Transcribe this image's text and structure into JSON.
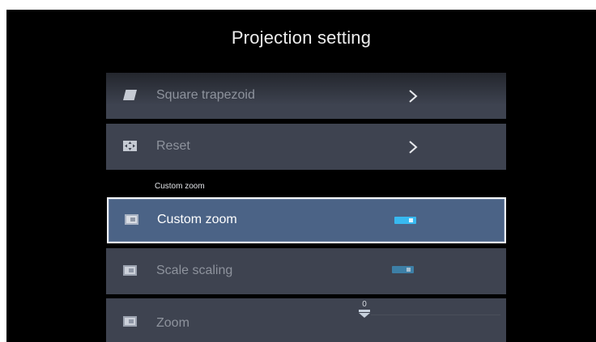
{
  "page": {
    "title": "Projection setting"
  },
  "menu": {
    "items": [
      {
        "label": "Square trapezoid",
        "icon": "trapezoid-icon",
        "action": "chevron-right-icon"
      },
      {
        "label": "Reset",
        "icon": "reset-icon",
        "action": "chevron-right-icon"
      }
    ],
    "section_label": "Custom zoom",
    "custom_zoom": {
      "label": "Custom zoom",
      "icon": "frame-icon",
      "toggle_state": "on"
    },
    "scale_scaling": {
      "label": "Scale scaling",
      "icon": "frame-icon",
      "toggle_state": "on"
    },
    "zoom": {
      "label": "Zoom",
      "icon": "frame-icon",
      "value": "0"
    }
  },
  "colors": {
    "background": "#000000",
    "row": "#3e4350",
    "focused_row": "#4b6386",
    "toggle_on": "#38b9f0"
  }
}
